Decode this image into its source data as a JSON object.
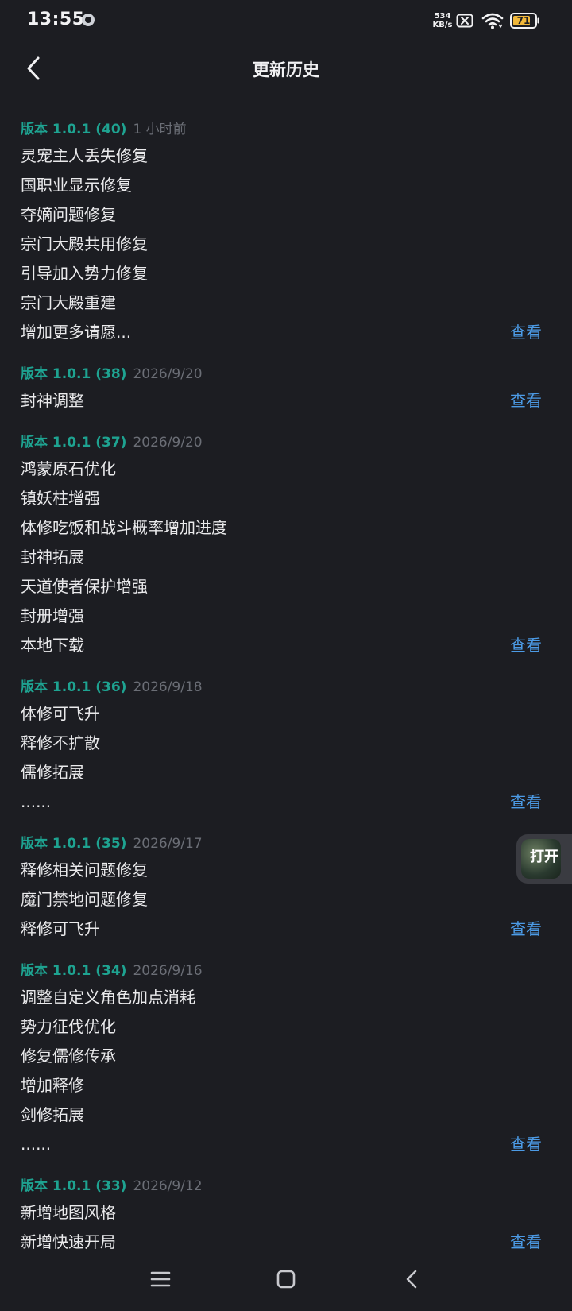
{
  "status_bar": {
    "time": "13:55",
    "net_speed_value": "534",
    "net_speed_unit": "KB/s",
    "battery_level": "71"
  },
  "header": {
    "title": "更新历史"
  },
  "versions": [
    {
      "label": "版本 1.0.1 (40)",
      "date": "1 小时前",
      "changes": [
        "灵宠主人丢失修复",
        "国职业显示修复",
        "夺嫡问题修复",
        "宗门大殿共用修复",
        "引导加入势力修复",
        "宗门大殿重建",
        "增加更多请愿..."
      ],
      "view_label": "查看"
    },
    {
      "label": "版本 1.0.1 (38)",
      "date": "2026/9/20",
      "changes": [
        "封神调整"
      ],
      "view_label": "查看"
    },
    {
      "label": "版本 1.0.1 (37)",
      "date": "2026/9/20",
      "changes": [
        "鸿蒙原石优化",
        "镇妖柱增强",
        "体修吃饭和战斗概率增加进度",
        "封神拓展",
        "天道使者保护增强",
        "封册增强",
        "本地下载"
      ],
      "view_label": "查看"
    },
    {
      "label": "版本 1.0.1 (36)",
      "date": "2026/9/18",
      "changes": [
        "体修可飞升",
        "释修不扩散",
        "儒修拓展",
        "......"
      ],
      "view_label": "查看"
    },
    {
      "label": "版本 1.0.1 (35)",
      "date": "2026/9/17",
      "changes": [
        "释修相关问题修复",
        "魔门禁地问题修复",
        "释修可飞升"
      ],
      "view_label": "查看"
    },
    {
      "label": "版本 1.0.1 (34)",
      "date": "2026/9/16",
      "changes": [
        "调整自定义角色加点消耗",
        "势力征伐优化",
        "修复儒修传承",
        "增加释修",
        "剑修拓展",
        "......"
      ],
      "view_label": "查看"
    },
    {
      "label": "版本 1.0.1 (33)",
      "date": "2026/9/12",
      "changes": [
        "新增地图风格",
        "新增快速开局"
      ],
      "view_label": "查看"
    }
  ],
  "floating_button": {
    "label": "打开"
  },
  "colors": {
    "background": "#1c1d22",
    "version_label": "#1ea391",
    "date_text": "#6b6e76",
    "link": "#4c9be6"
  },
  "icons": {
    "back": "chevron-left-icon",
    "nav_menu": "menu-icon",
    "nav_home": "square-home-icon",
    "nav_back": "triangle-back-icon"
  }
}
